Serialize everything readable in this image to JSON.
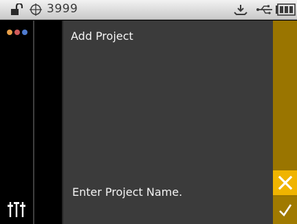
{
  "status_bar": {
    "device_id": "3999",
    "icons": [
      "lock-open-icon",
      "target-icon",
      "download-icon",
      "usb-icon",
      "battery-icon"
    ]
  },
  "sidebar": {
    "icons": [
      "colored-dots-icon",
      "adjust-sliders-icon"
    ],
    "dot_colors": [
      "#e8a048",
      "#d05a5a",
      "#4f7bd0"
    ]
  },
  "main": {
    "title": "Add Project",
    "prompt": "Enter Project Name."
  },
  "actions": {
    "cancel_icon": "close-icon",
    "confirm_icon": "check-icon"
  },
  "colors": {
    "accent": "#f0b400",
    "accent_dark": "#9a7500",
    "panel": "#3b3b3b",
    "status_bar": "#dcdcdc"
  }
}
